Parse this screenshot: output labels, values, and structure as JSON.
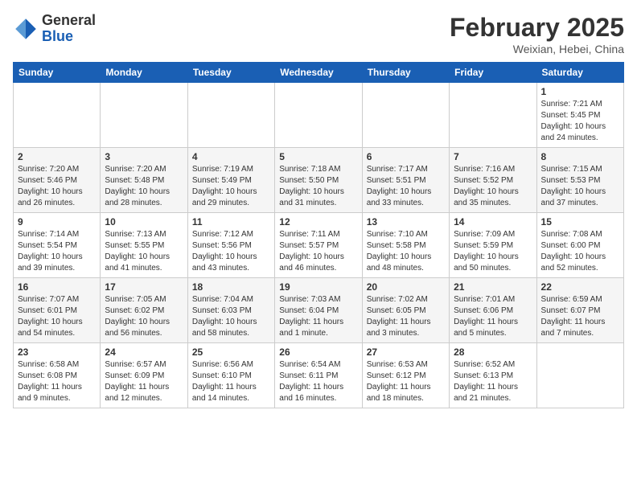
{
  "logo": {
    "general": "General",
    "blue": "Blue"
  },
  "header": {
    "month": "February 2025",
    "location": "Weixian, Hebei, China"
  },
  "weekdays": [
    "Sunday",
    "Monday",
    "Tuesday",
    "Wednesday",
    "Thursday",
    "Friday",
    "Saturday"
  ],
  "weeks": [
    [
      null,
      null,
      null,
      null,
      null,
      null,
      {
        "day": "1",
        "sunrise": "Sunrise: 7:21 AM",
        "sunset": "Sunset: 5:45 PM",
        "daylight": "Daylight: 10 hours and 24 minutes."
      }
    ],
    [
      {
        "day": "2",
        "sunrise": "Sunrise: 7:20 AM",
        "sunset": "Sunset: 5:46 PM",
        "daylight": "Daylight: 10 hours and 26 minutes."
      },
      {
        "day": "3",
        "sunrise": "Sunrise: 7:20 AM",
        "sunset": "Sunset: 5:48 PM",
        "daylight": "Daylight: 10 hours and 28 minutes."
      },
      {
        "day": "4",
        "sunrise": "Sunrise: 7:19 AM",
        "sunset": "Sunset: 5:49 PM",
        "daylight": "Daylight: 10 hours and 29 minutes."
      },
      {
        "day": "5",
        "sunrise": "Sunrise: 7:18 AM",
        "sunset": "Sunset: 5:50 PM",
        "daylight": "Daylight: 10 hours and 31 minutes."
      },
      {
        "day": "6",
        "sunrise": "Sunrise: 7:17 AM",
        "sunset": "Sunset: 5:51 PM",
        "daylight": "Daylight: 10 hours and 33 minutes."
      },
      {
        "day": "7",
        "sunrise": "Sunrise: 7:16 AM",
        "sunset": "Sunset: 5:52 PM",
        "daylight": "Daylight: 10 hours and 35 minutes."
      },
      {
        "day": "8",
        "sunrise": "Sunrise: 7:15 AM",
        "sunset": "Sunset: 5:53 PM",
        "daylight": "Daylight: 10 hours and 37 minutes."
      }
    ],
    [
      {
        "day": "9",
        "sunrise": "Sunrise: 7:14 AM",
        "sunset": "Sunset: 5:54 PM",
        "daylight": "Daylight: 10 hours and 39 minutes."
      },
      {
        "day": "10",
        "sunrise": "Sunrise: 7:13 AM",
        "sunset": "Sunset: 5:55 PM",
        "daylight": "Daylight: 10 hours and 41 minutes."
      },
      {
        "day": "11",
        "sunrise": "Sunrise: 7:12 AM",
        "sunset": "Sunset: 5:56 PM",
        "daylight": "Daylight: 10 hours and 43 minutes."
      },
      {
        "day": "12",
        "sunrise": "Sunrise: 7:11 AM",
        "sunset": "Sunset: 5:57 PM",
        "daylight": "Daylight: 10 hours and 46 minutes."
      },
      {
        "day": "13",
        "sunrise": "Sunrise: 7:10 AM",
        "sunset": "Sunset: 5:58 PM",
        "daylight": "Daylight: 10 hours and 48 minutes."
      },
      {
        "day": "14",
        "sunrise": "Sunrise: 7:09 AM",
        "sunset": "Sunset: 5:59 PM",
        "daylight": "Daylight: 10 hours and 50 minutes."
      },
      {
        "day": "15",
        "sunrise": "Sunrise: 7:08 AM",
        "sunset": "Sunset: 6:00 PM",
        "daylight": "Daylight: 10 hours and 52 minutes."
      }
    ],
    [
      {
        "day": "16",
        "sunrise": "Sunrise: 7:07 AM",
        "sunset": "Sunset: 6:01 PM",
        "daylight": "Daylight: 10 hours and 54 minutes."
      },
      {
        "day": "17",
        "sunrise": "Sunrise: 7:05 AM",
        "sunset": "Sunset: 6:02 PM",
        "daylight": "Daylight: 10 hours and 56 minutes."
      },
      {
        "day": "18",
        "sunrise": "Sunrise: 7:04 AM",
        "sunset": "Sunset: 6:03 PM",
        "daylight": "Daylight: 10 hours and 58 minutes."
      },
      {
        "day": "19",
        "sunrise": "Sunrise: 7:03 AM",
        "sunset": "Sunset: 6:04 PM",
        "daylight": "Daylight: 11 hours and 1 minute."
      },
      {
        "day": "20",
        "sunrise": "Sunrise: 7:02 AM",
        "sunset": "Sunset: 6:05 PM",
        "daylight": "Daylight: 11 hours and 3 minutes."
      },
      {
        "day": "21",
        "sunrise": "Sunrise: 7:01 AM",
        "sunset": "Sunset: 6:06 PM",
        "daylight": "Daylight: 11 hours and 5 minutes."
      },
      {
        "day": "22",
        "sunrise": "Sunrise: 6:59 AM",
        "sunset": "Sunset: 6:07 PM",
        "daylight": "Daylight: 11 hours and 7 minutes."
      }
    ],
    [
      {
        "day": "23",
        "sunrise": "Sunrise: 6:58 AM",
        "sunset": "Sunset: 6:08 PM",
        "daylight": "Daylight: 11 hours and 9 minutes."
      },
      {
        "day": "24",
        "sunrise": "Sunrise: 6:57 AM",
        "sunset": "Sunset: 6:09 PM",
        "daylight": "Daylight: 11 hours and 12 minutes."
      },
      {
        "day": "25",
        "sunrise": "Sunrise: 6:56 AM",
        "sunset": "Sunset: 6:10 PM",
        "daylight": "Daylight: 11 hours and 14 minutes."
      },
      {
        "day": "26",
        "sunrise": "Sunrise: 6:54 AM",
        "sunset": "Sunset: 6:11 PM",
        "daylight": "Daylight: 11 hours and 16 minutes."
      },
      {
        "day": "27",
        "sunrise": "Sunrise: 6:53 AM",
        "sunset": "Sunset: 6:12 PM",
        "daylight": "Daylight: 11 hours and 18 minutes."
      },
      {
        "day": "28",
        "sunrise": "Sunrise: 6:52 AM",
        "sunset": "Sunset: 6:13 PM",
        "daylight": "Daylight: 11 hours and 21 minutes."
      },
      null
    ]
  ]
}
